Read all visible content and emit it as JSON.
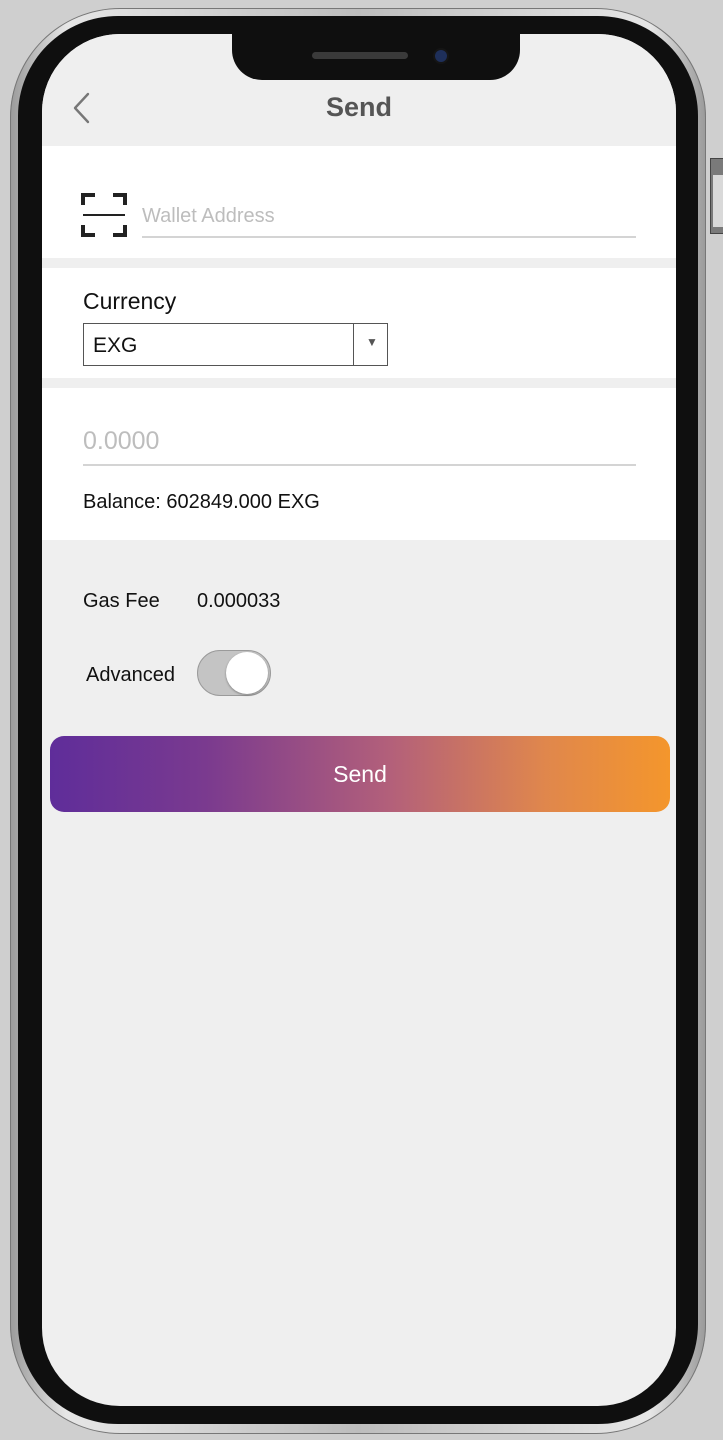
{
  "header": {
    "title": "Send",
    "back_icon": "chevron-left-icon"
  },
  "address": {
    "placeholder": "Wallet Address",
    "value": "",
    "scan_icon": "scan-qr-icon"
  },
  "currency": {
    "label": "Currency",
    "selected": "EXG",
    "arrow": "▼"
  },
  "amount": {
    "placeholder": "0.0000",
    "value": "",
    "balance_text": "Balance: 602849.000 EXG"
  },
  "gas_fee": {
    "label": "Gas Fee",
    "value": "0.000033"
  },
  "advanced": {
    "label": "Advanced",
    "enabled": false
  },
  "send_button": {
    "label": "Send",
    "gradient_start": "#5f2d9a",
    "gradient_end": "#f4962c"
  },
  "colors": {
    "screen_background": "#efefef",
    "card_background": "#ffffff",
    "title_text": "#555555",
    "placeholder_text": "#bdbdbd"
  }
}
